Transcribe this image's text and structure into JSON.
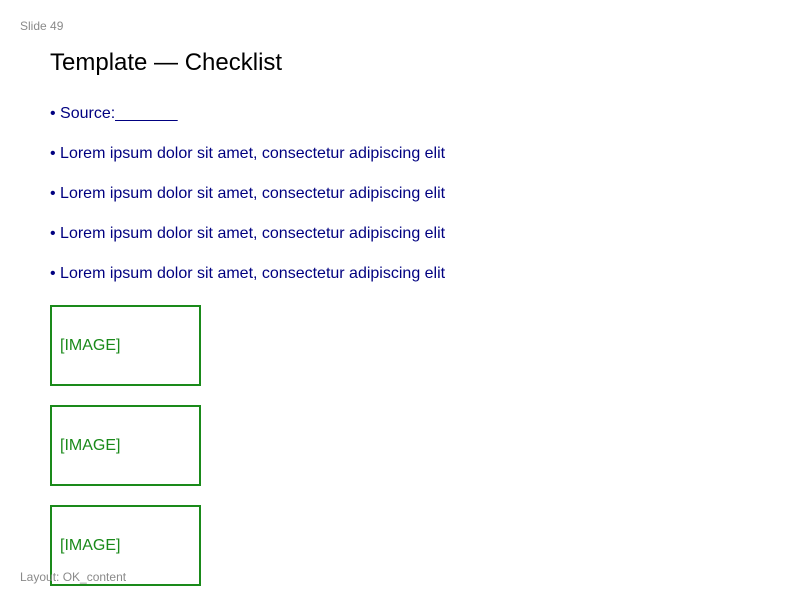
{
  "slide": {
    "number_label": "Slide 49",
    "title": "Template — Checklist",
    "layout_label": "Layout: OK_content"
  },
  "bullets": [
    "• Source:_______",
    "• Lorem ipsum dolor sit amet, consectetur adipiscing elit",
    "• Lorem ipsum dolor sit amet, consectetur adipiscing elit",
    "• Lorem ipsum dolor sit amet, consectetur adipiscing elit",
    "• Lorem ipsum dolor sit amet, consectetur adipiscing elit"
  ],
  "image_placeholders": [
    "[IMAGE]",
    "[IMAGE]",
    "[IMAGE]"
  ],
  "colors": {
    "bullet_text": "#000080",
    "placeholder": "#1a8a1a",
    "meta_text": "#8a8a8a",
    "title_text": "#000000"
  }
}
